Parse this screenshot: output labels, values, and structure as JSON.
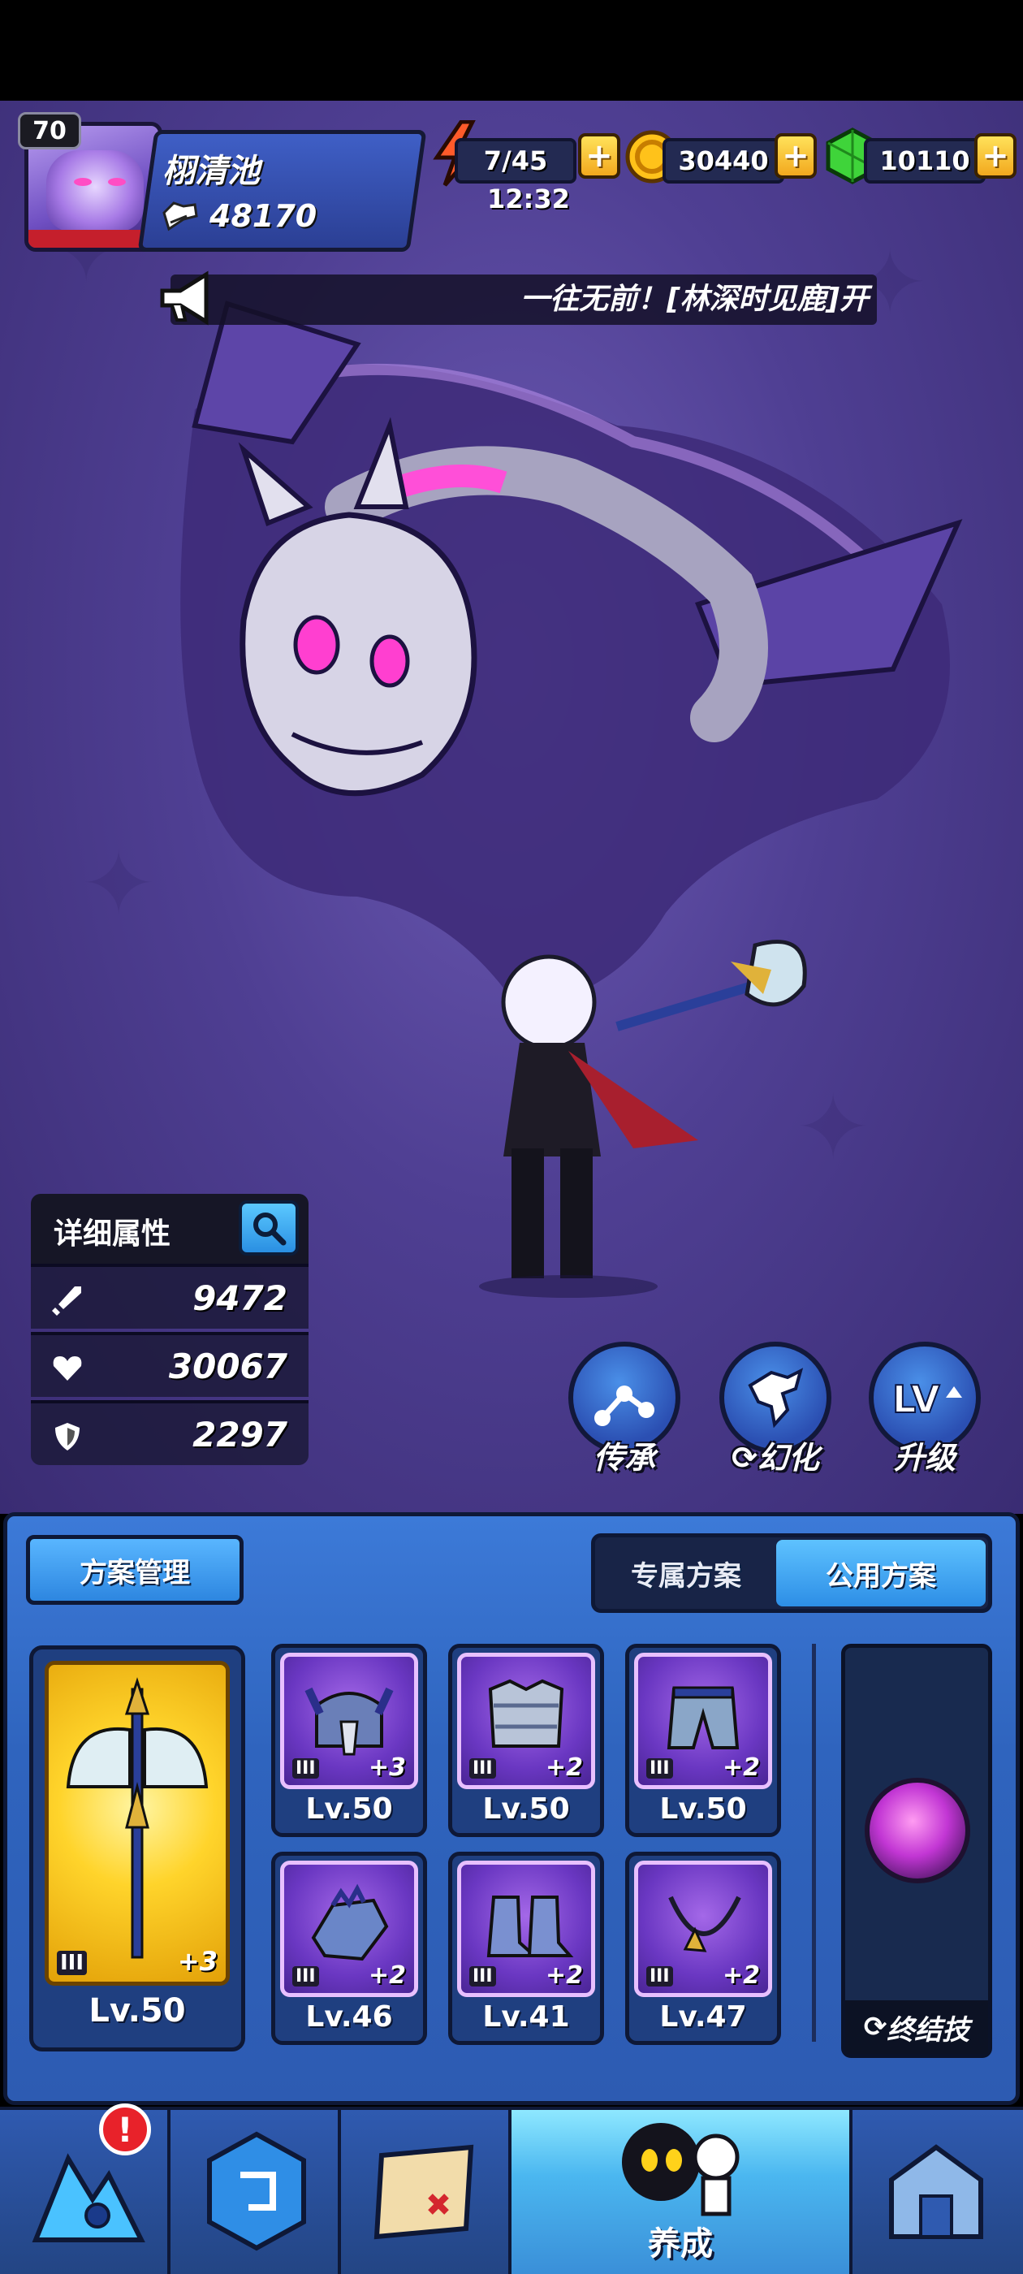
{
  "player": {
    "level": "70",
    "name": "栩清池",
    "power": "48170"
  },
  "resources": {
    "energy": "7/45",
    "energy_timer": "12:32",
    "gold": "30440",
    "gems": "10110",
    "plus_label": "+"
  },
  "announcement": "一往无前！[林深时见鹿]开",
  "stats": {
    "title": "详细属性",
    "attack": "9472",
    "hp": "30067",
    "defense": "2297"
  },
  "actions": {
    "inherit": "传承",
    "transform": "幻化",
    "upgrade": "升级"
  },
  "panel": {
    "plan_manage": "方案管理",
    "tab_exclusive": "专属方案",
    "tab_public": "公用方案",
    "weapon": {
      "tier": "III",
      "plus": "+3",
      "level": "Lv.50"
    },
    "equipment": [
      {
        "tier": "III",
        "plus": "+3",
        "level": "Lv.50"
      },
      {
        "tier": "III",
        "plus": "+2",
        "level": "Lv.50"
      },
      {
        "tier": "III",
        "plus": "+2",
        "level": "Lv.50"
      },
      {
        "tier": "III",
        "plus": "+2",
        "level": "Lv.46"
      },
      {
        "tier": "III",
        "plus": "+2",
        "level": "Lv.41"
      },
      {
        "tier": "III",
        "plus": "+2",
        "level": "Lv.47"
      }
    ],
    "ultimate_label": "终结技"
  },
  "nav": {
    "active_label": "养成",
    "alert": "!"
  },
  "colors": {
    "accent_blue": "#2d86e0",
    "gold": "#ffd42b",
    "epic_purple": "#6a37c2",
    "alert_red": "#e8222a"
  },
  "icons": [
    "energy-bolt-icon",
    "gold-coin-icon",
    "green-gem-icon",
    "megaphone-icon",
    "search-icon",
    "sword-icon",
    "heart-icon",
    "shield-icon",
    "inherit-icon",
    "transform-icon",
    "level-up-icon",
    "swap-icon"
  ]
}
